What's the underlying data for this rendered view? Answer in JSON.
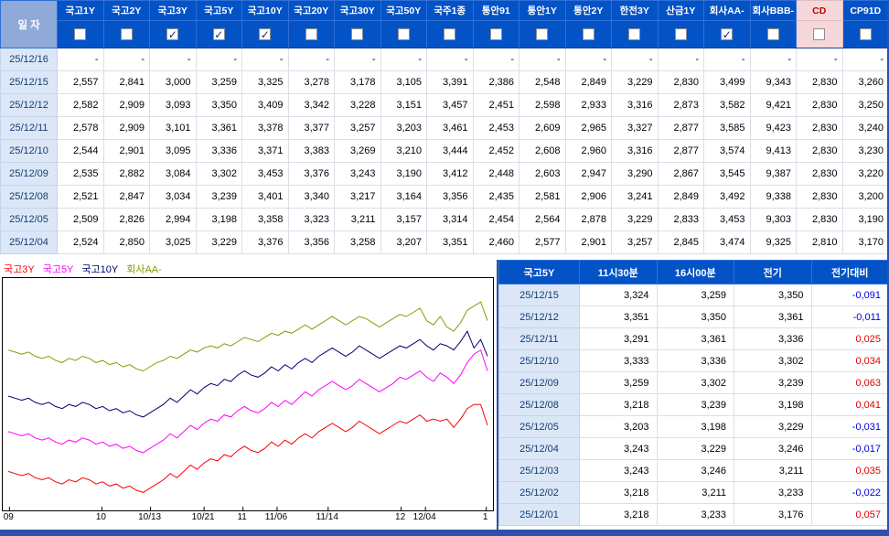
{
  "colors": {
    "header_blue": "#0353c7",
    "date_header_blue": "#8fa9d9",
    "date_cell_bg": "#dbe7f7",
    "cd_pink_bg": "#f6d7d9",
    "cd_pink_text": "#c00000",
    "positive_red": "#e00000",
    "negative_blue": "#0000e0",
    "frame_blue": "#2d50a8"
  },
  "top_table": {
    "date_header": "일 자",
    "columns": [
      {
        "label": "국고1Y",
        "checked": false
      },
      {
        "label": "국고2Y",
        "checked": false
      },
      {
        "label": "국고3Y",
        "checked": true
      },
      {
        "label": "국고5Y",
        "checked": true
      },
      {
        "label": "국고10Y",
        "checked": true
      },
      {
        "label": "국고20Y",
        "checked": false
      },
      {
        "label": "국고30Y",
        "checked": false
      },
      {
        "label": "국고50Y",
        "checked": false
      },
      {
        "label": "국주1종",
        "checked": false
      },
      {
        "label": "통안91",
        "checked": false
      },
      {
        "label": "통안1Y",
        "checked": false
      },
      {
        "label": "통안2Y",
        "checked": false
      },
      {
        "label": "한전3Y",
        "checked": false
      },
      {
        "label": "산금1Y",
        "checked": false
      },
      {
        "label": "회사AA-",
        "checked": true
      },
      {
        "label": "회사BBB-",
        "checked": false
      },
      {
        "label": "CD",
        "checked": false,
        "highlight": true
      },
      {
        "label": "CP91D",
        "checked": false
      }
    ],
    "rows": [
      {
        "date": "25/12/16",
        "values": [
          "-",
          "-",
          "-",
          "-",
          "-",
          "-",
          "-",
          "-",
          "-",
          "-",
          "-",
          "-",
          "-",
          "-",
          "-",
          "-",
          "-",
          "-"
        ]
      },
      {
        "date": "25/12/15",
        "values": [
          "2,557",
          "2,841",
          "3,000",
          "3,259",
          "3,325",
          "3,278",
          "3,178",
          "3,105",
          "3,391",
          "2,386",
          "2,548",
          "2,849",
          "3,229",
          "2,830",
          "3,499",
          "9,343",
          "2,830",
          "3,260"
        ]
      },
      {
        "date": "25/12/12",
        "values": [
          "2,582",
          "2,909",
          "3,093",
          "3,350",
          "3,409",
          "3,342",
          "3,228",
          "3,151",
          "3,457",
          "2,451",
          "2,598",
          "2,933",
          "3,316",
          "2,873",
          "3,582",
          "9,421",
          "2,830",
          "3,250"
        ]
      },
      {
        "date": "25/12/11",
        "values": [
          "2,578",
          "2,909",
          "3,101",
          "3,361",
          "3,378",
          "3,377",
          "3,257",
          "3,203",
          "3,461",
          "2,453",
          "2,609",
          "2,965",
          "3,327",
          "2,877",
          "3,585",
          "9,423",
          "2,830",
          "3,240"
        ]
      },
      {
        "date": "25/12/10",
        "values": [
          "2,544",
          "2,901",
          "3,095",
          "3,336",
          "3,371",
          "3,383",
          "3,269",
          "3,210",
          "3,444",
          "2,452",
          "2,608",
          "2,960",
          "3,316",
          "2,877",
          "3,574",
          "9,413",
          "2,830",
          "3,230"
        ]
      },
      {
        "date": "25/12/09",
        "values": [
          "2,535",
          "2,882",
          "3,084",
          "3,302",
          "3,453",
          "3,376",
          "3,243",
          "3,190",
          "3,412",
          "2,448",
          "2,603",
          "2,947",
          "3,290",
          "2,867",
          "3,545",
          "9,387",
          "2,830",
          "3,220"
        ]
      },
      {
        "date": "25/12/08",
        "values": [
          "2,521",
          "2,847",
          "3,034",
          "3,239",
          "3,401",
          "3,340",
          "3,217",
          "3,164",
          "3,356",
          "2,435",
          "2,581",
          "2,906",
          "3,241",
          "2,849",
          "3,492",
          "9,338",
          "2,830",
          "3,200"
        ]
      },
      {
        "date": "25/12/05",
        "values": [
          "2,509",
          "2,826",
          "2,994",
          "3,198",
          "3,358",
          "3,323",
          "3,211",
          "3,157",
          "3,314",
          "2,454",
          "2,564",
          "2,878",
          "3,229",
          "2,833",
          "3,453",
          "9,303",
          "2,830",
          "3,190"
        ]
      },
      {
        "date": "25/12/04",
        "values": [
          "2,524",
          "2,850",
          "3,025",
          "3,229",
          "3,376",
          "3,356",
          "3,258",
          "3,207",
          "3,351",
          "2,460",
          "2,577",
          "2,901",
          "3,257",
          "2,845",
          "3,474",
          "9,325",
          "2,810",
          "3,170"
        ]
      }
    ]
  },
  "chart_data": {
    "type": "line",
    "title": "",
    "xlabel": "",
    "ylabel": "",
    "grid": false,
    "legend_position": "top-left",
    "ylim": [
      2.62,
      3.66
    ],
    "x_ticks": [
      "09",
      "10",
      "10/13",
      "10/21",
      "11",
      "11/06",
      "11/14",
      "12",
      "12/04",
      "1"
    ],
    "x_tick_fractions": [
      0.01,
      0.2,
      0.3,
      0.41,
      0.49,
      0.56,
      0.665,
      0.815,
      0.865,
      0.99
    ],
    "series": [
      {
        "name": "국고3Y",
        "color": "#ff0000",
        "values": [
          2.78,
          2.77,
          2.76,
          2.77,
          2.75,
          2.74,
          2.75,
          2.73,
          2.72,
          2.74,
          2.73,
          2.75,
          2.74,
          2.72,
          2.73,
          2.71,
          2.72,
          2.7,
          2.71,
          2.69,
          2.68,
          2.7,
          2.72,
          2.74,
          2.77,
          2.75,
          2.78,
          2.81,
          2.79,
          2.82,
          2.84,
          2.83,
          2.86,
          2.85,
          2.88,
          2.9,
          2.88,
          2.87,
          2.89,
          2.92,
          2.9,
          2.93,
          2.91,
          2.94,
          2.96,
          2.94,
          2.97,
          2.99,
          3.01,
          2.99,
          2.97,
          2.99,
          3.02,
          3.0,
          2.98,
          2.96,
          2.98,
          3.0,
          3.02,
          3.01,
          3.03,
          3.05,
          3.02,
          3.03,
          3.02,
          3.03,
          2.99,
          3.03,
          3.08,
          3.1,
          3.1,
          3.0
        ]
      },
      {
        "name": "국고5Y",
        "color": "#ff00ff",
        "values": [
          2.97,
          2.96,
          2.95,
          2.96,
          2.94,
          2.93,
          2.94,
          2.92,
          2.91,
          2.93,
          2.92,
          2.94,
          2.93,
          2.91,
          2.92,
          2.9,
          2.91,
          2.89,
          2.9,
          2.88,
          2.87,
          2.89,
          2.91,
          2.93,
          2.96,
          2.94,
          2.97,
          3.0,
          2.98,
          3.01,
          3.03,
          3.02,
          3.05,
          3.04,
          3.07,
          3.09,
          3.07,
          3.06,
          3.08,
          3.11,
          3.09,
          3.12,
          3.1,
          3.13,
          3.16,
          3.14,
          3.17,
          3.19,
          3.21,
          3.19,
          3.17,
          3.19,
          3.22,
          3.2,
          3.18,
          3.16,
          3.18,
          3.2,
          3.23,
          3.22,
          3.24,
          3.26,
          3.23,
          3.21,
          3.25,
          3.23,
          3.2,
          3.24,
          3.3,
          3.34,
          3.36,
          3.26
        ]
      },
      {
        "name": "국고10Y",
        "color": "#000070",
        "values": [
          3.14,
          3.13,
          3.12,
          3.13,
          3.11,
          3.1,
          3.11,
          3.09,
          3.08,
          3.1,
          3.09,
          3.11,
          3.1,
          3.08,
          3.09,
          3.07,
          3.08,
          3.06,
          3.07,
          3.05,
          3.04,
          3.06,
          3.08,
          3.1,
          3.13,
          3.11,
          3.14,
          3.17,
          3.15,
          3.18,
          3.2,
          3.19,
          3.22,
          3.21,
          3.24,
          3.26,
          3.24,
          3.23,
          3.25,
          3.28,
          3.26,
          3.29,
          3.27,
          3.3,
          3.32,
          3.3,
          3.33,
          3.35,
          3.37,
          3.35,
          3.33,
          3.35,
          3.38,
          3.36,
          3.34,
          3.32,
          3.34,
          3.36,
          3.38,
          3.37,
          3.39,
          3.41,
          3.38,
          3.36,
          3.39,
          3.38,
          3.36,
          3.4,
          3.45,
          3.37,
          3.41,
          3.33
        ]
      },
      {
        "name": "회사AA-",
        "color": "#7da000",
        "values": [
          3.36,
          3.35,
          3.34,
          3.35,
          3.33,
          3.32,
          3.33,
          3.31,
          3.3,
          3.32,
          3.31,
          3.33,
          3.32,
          3.3,
          3.31,
          3.29,
          3.3,
          3.28,
          3.29,
          3.27,
          3.26,
          3.28,
          3.3,
          3.31,
          3.33,
          3.32,
          3.34,
          3.36,
          3.35,
          3.37,
          3.38,
          3.37,
          3.39,
          3.38,
          3.4,
          3.42,
          3.41,
          3.4,
          3.42,
          3.44,
          3.43,
          3.45,
          3.44,
          3.46,
          3.48,
          3.46,
          3.48,
          3.5,
          3.52,
          3.5,
          3.48,
          3.5,
          3.52,
          3.51,
          3.49,
          3.47,
          3.49,
          3.51,
          3.53,
          3.52,
          3.54,
          3.56,
          3.5,
          3.48,
          3.52,
          3.47,
          3.45,
          3.49,
          3.55,
          3.57,
          3.59,
          3.5
        ]
      }
    ]
  },
  "right_table": {
    "headers": [
      "국고5Y",
      "11시30분",
      "16시00분",
      "전기",
      "전기대비"
    ],
    "rows": [
      {
        "date": "25/12/15",
        "t1130": "3,324",
        "t1600": "3,259",
        "prev": "3,350",
        "diff": "-0,091"
      },
      {
        "date": "25/12/12",
        "t1130": "3,351",
        "t1600": "3,350",
        "prev": "3,361",
        "diff": "-0,011"
      },
      {
        "date": "25/12/11",
        "t1130": "3,291",
        "t1600": "3,361",
        "prev": "3,336",
        "diff": "0,025"
      },
      {
        "date": "25/12/10",
        "t1130": "3,333",
        "t1600": "3,336",
        "prev": "3,302",
        "diff": "0,034"
      },
      {
        "date": "25/12/09",
        "t1130": "3,259",
        "t1600": "3,302",
        "prev": "3,239",
        "diff": "0,063"
      },
      {
        "date": "25/12/08",
        "t1130": "3,218",
        "t1600": "3,239",
        "prev": "3,198",
        "diff": "0,041"
      },
      {
        "date": "25/12/05",
        "t1130": "3,203",
        "t1600": "3,198",
        "prev": "3,229",
        "diff": "-0,031"
      },
      {
        "date": "25/12/04",
        "t1130": "3,243",
        "t1600": "3,229",
        "prev": "3,246",
        "diff": "-0,017"
      },
      {
        "date": "25/12/03",
        "t1130": "3,243",
        "t1600": "3,246",
        "prev": "3,211",
        "diff": "0,035"
      },
      {
        "date": "25/12/02",
        "t1130": "3,218",
        "t1600": "3,211",
        "prev": "3,233",
        "diff": "-0,022"
      },
      {
        "date": "25/12/01",
        "t1130": "3,218",
        "t1600": "3,233",
        "prev": "3,176",
        "diff": "0,057"
      }
    ]
  }
}
